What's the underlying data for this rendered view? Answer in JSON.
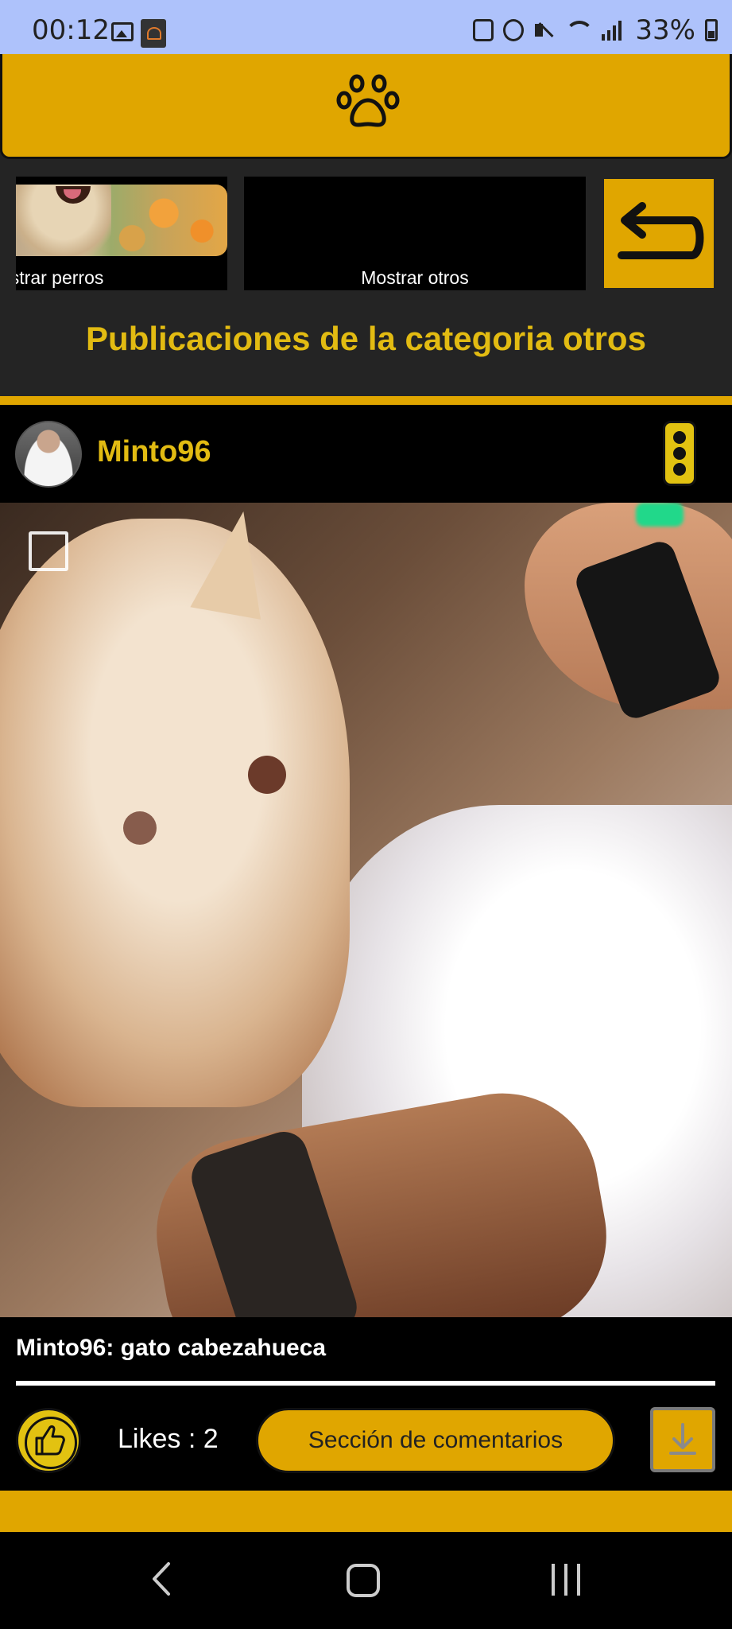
{
  "status": {
    "time": "00:12",
    "battery": "33%",
    "icons": [
      "image-icon",
      "app-icon",
      "battery-saver-icon",
      "alarm-icon",
      "mute-icon",
      "wifi-icon",
      "signal-icon",
      "battery-icon"
    ]
  },
  "header": {
    "icon": "paw-icon"
  },
  "categories": [
    {
      "label": "ostrar perros",
      "full_label": "Mostrar perros"
    },
    {
      "label": "Mostrar otros"
    }
  ],
  "back_button": {
    "icon": "undo-arrow-icon"
  },
  "section_title": "Publicaciones de la categoria otros",
  "post": {
    "username": "Minto96",
    "caption": "Minto96: gato cabezahueca",
    "likes": "Likes : 2",
    "comments_label": "Sección de comentarios",
    "icons": [
      "like-icon",
      "download-icon",
      "more-options-icon",
      "select-checkbox-icon"
    ]
  },
  "colors": {
    "accent": "#e0a600",
    "title_yellow": "#e2bb12",
    "background": "#242424",
    "status_bar": "#aec2fb"
  },
  "nav": [
    "back-icon",
    "home-icon",
    "recent-apps-icon"
  ]
}
